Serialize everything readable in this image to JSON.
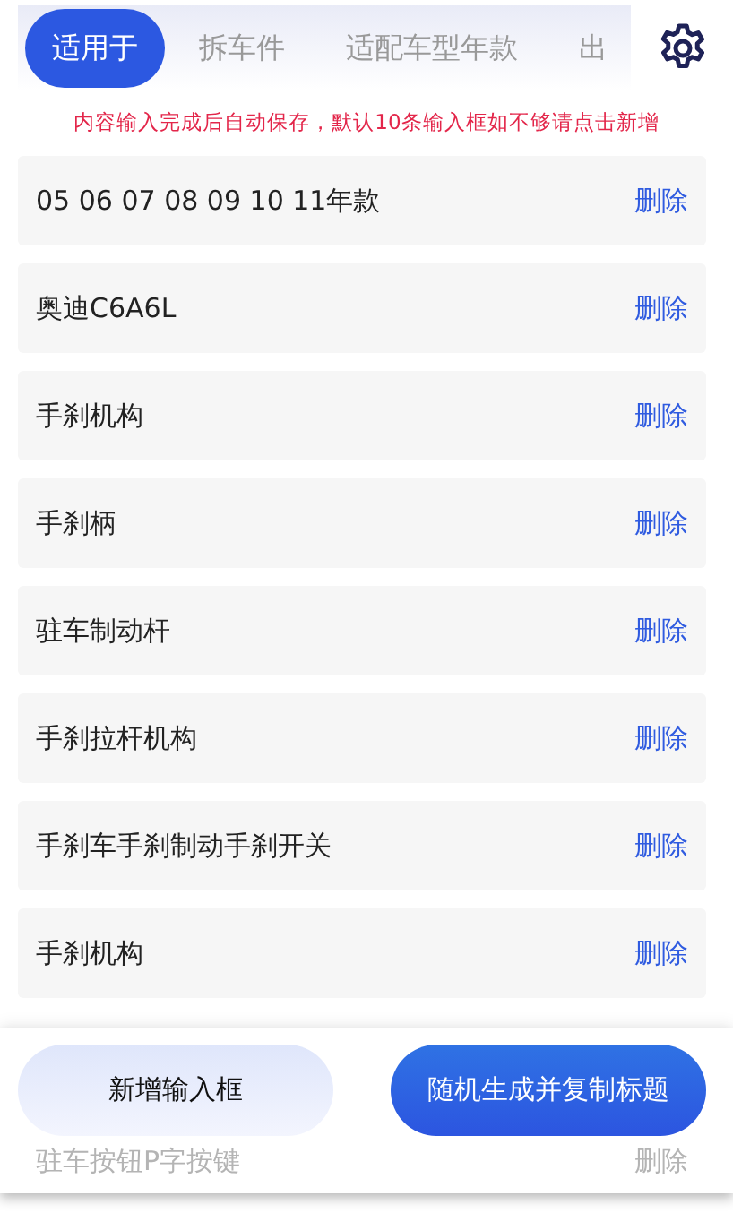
{
  "tabs": [
    {
      "label": "适用于",
      "selected": true
    },
    {
      "label": "拆车件",
      "selected": false
    },
    {
      "label": "适配车型年款",
      "selected": false
    },
    {
      "label": "出",
      "selected": false
    }
  ],
  "notice": "内容输入完成后自动保存，默认10条输入框如不够请点击新增",
  "entries": [
    {
      "text": "05 06 07 08 09 10 11年款",
      "action": "删除"
    },
    {
      "text": "奥迪C6A6L",
      "action": "删除"
    },
    {
      "text": "手刹机构",
      "action": "删除"
    },
    {
      "text": "手刹柄",
      "action": "删除"
    },
    {
      "text": "驻车制动杆",
      "action": "删除"
    },
    {
      "text": "手刹拉杆机构",
      "action": "删除"
    },
    {
      "text": "手刹车手刹制动手刹开关",
      "action": "删除"
    },
    {
      "text": "手刹机构",
      "action": "删除"
    },
    {
      "text": "驻车按钮P字按键",
      "action": "删除",
      "faded": true
    }
  ],
  "buttons": [
    {
      "label": "新增输入框",
      "kind": "secondary"
    },
    {
      "label": "随机生成并复制标题",
      "kind": "primary"
    }
  ]
}
